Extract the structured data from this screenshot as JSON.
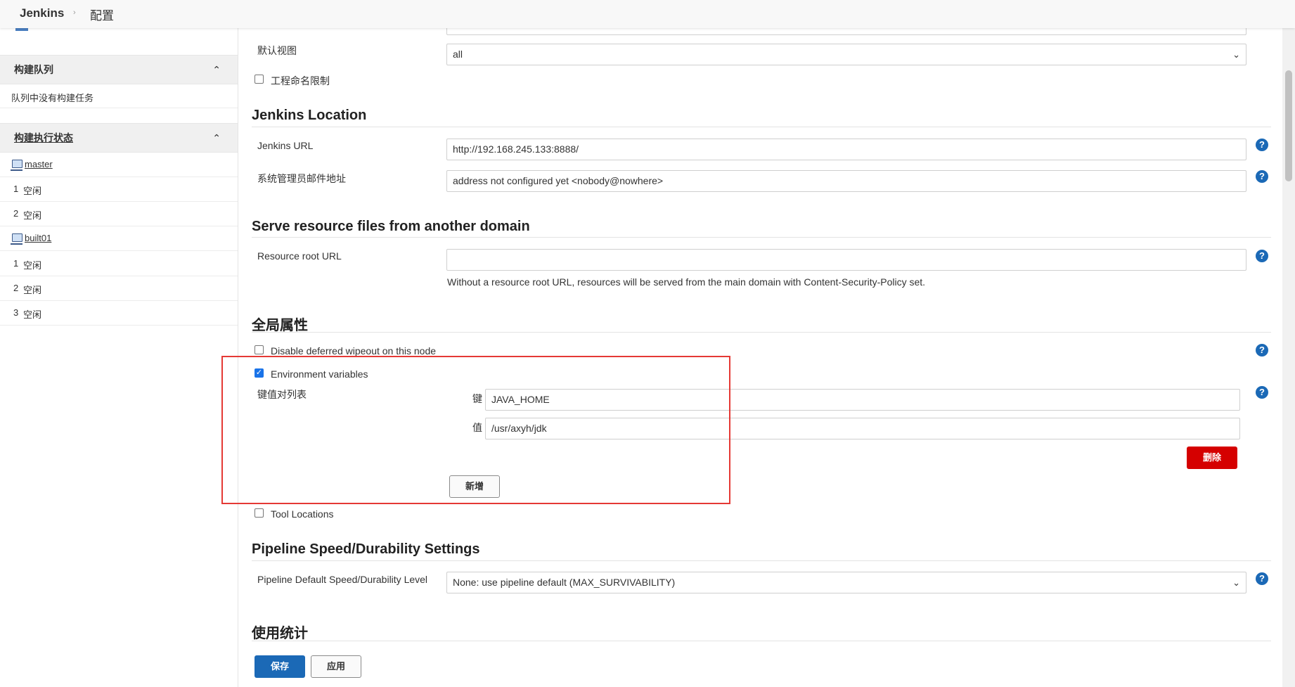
{
  "breadcrumb": {
    "home": "Jenkins",
    "separator": "›",
    "current": "配置"
  },
  "sidebar": {
    "queue": {
      "title": "构建队列",
      "empty_text": "队列中没有构建任务"
    },
    "executors": {
      "title": "构建执行状态",
      "nodes": [
        {
          "name": "master",
          "slots": [
            {
              "num": "1",
              "status": "空闲"
            },
            {
              "num": "2",
              "status": "空闲"
            }
          ]
        },
        {
          "name": "built01",
          "slots": [
            {
              "num": "1",
              "status": "空闲"
            },
            {
              "num": "2",
              "status": "空闲"
            },
            {
              "num": "3",
              "status": "空闲"
            }
          ]
        }
      ]
    }
  },
  "main": {
    "default_view": {
      "label": "默认视图",
      "value": "all"
    },
    "project_naming": {
      "label": "工程命名限制",
      "checked": false
    },
    "jenkins_location": {
      "title": "Jenkins Location",
      "url_label": "Jenkins URL",
      "url_value": "http://192.168.245.133:8888/",
      "email_label": "系统管理员邮件地址",
      "email_value": "address not configured yet <nobody@nowhere>"
    },
    "resource_domain": {
      "title": "Serve resource files from another domain",
      "label": "Resource root URL",
      "value": "",
      "hint": "Without a resource root URL, resources will be served from the main domain with Content-Security-Policy set."
    },
    "global_props": {
      "title": "全局属性",
      "deferred_wipeout": {
        "label": "Disable deferred wipeout on this node",
        "checked": false
      },
      "env_vars": {
        "label": "Environment variables",
        "checked": true,
        "list_label": "键值对列表",
        "key_label": "键",
        "key_value": "JAVA_HOME",
        "value_label": "值",
        "value_value": "/usr/axyh/jdk",
        "delete_label": "删除",
        "add_label": "新增"
      },
      "tool_locations": {
        "label": "Tool Locations",
        "checked": false
      }
    },
    "pipeline": {
      "title": "Pipeline Speed/Durability Settings",
      "label": "Pipeline Default Speed/Durability Level",
      "value": "None: use pipeline default (MAX_SURVIVABILITY)"
    },
    "usage": {
      "title": "使用统计"
    },
    "buttons": {
      "save": "保存",
      "apply": "应用"
    },
    "help_glyph": "?",
    "chevron_up": "⌃",
    "select_arrow": "⌄",
    "check_mark": "✓"
  },
  "colors": {
    "accent": "#1b69b6",
    "danger": "#d50000",
    "highlight_box": "#e53935"
  }
}
